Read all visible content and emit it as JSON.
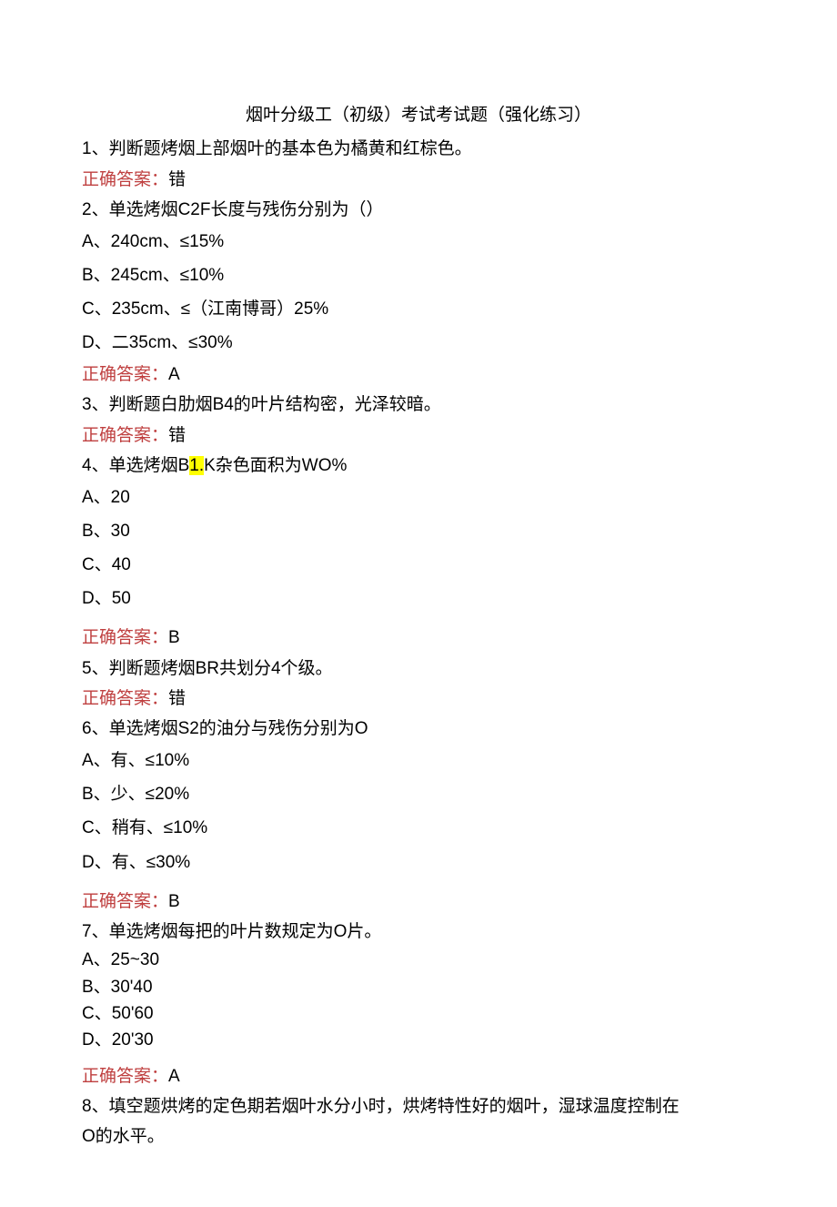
{
  "title": "烟叶分级工（初级）考试考试题（强化练习）",
  "answerLabel": "正确答案：",
  "q1": {
    "text": "1、判断题烤烟上部烟叶的基本色为橘黄和红棕色。",
    "answer": "错"
  },
  "q2": {
    "text": "2、单选烤烟C2F长度与残伤分别为（）",
    "optA": "A、240cm、≤15%",
    "optB": "B、245cm、≤10%",
    "optC": "C、235cm、≤（江南博哥）25%",
    "optD": "D、二35cm、≤30%",
    "answer": "A"
  },
  "q3": {
    "text": "3、判断题白肋烟B4的叶片结构密，光泽较暗。",
    "answer": "错"
  },
  "q4": {
    "textPre": "4、单选烤烟B",
    "hl": "1.",
    "textPost": "K杂色面积为WO%",
    "optA": "A、20",
    "optB": "B、30",
    "optC": "C、40",
    "optD": "D、50",
    "answer": "B"
  },
  "q5": {
    "text": "5、判断题烤烟BR共划分4个级。",
    "answer": "错"
  },
  "q6": {
    "text": "6、单选烤烟S2的油分与残伤分别为O",
    "optA": "A、有、≤10%",
    "optB": "B、少、≤20%",
    "optC": "C、稍有、≤10%",
    "optD": "D、有、≤30%",
    "answer": "B"
  },
  "q7": {
    "text": "7、单选烤烟每把的叶片数规定为O片。",
    "optA": "A、25~30",
    "optB": "B、30'40",
    "optC": "C、50'60",
    "optD": "D、20'30",
    "answer": "A"
  },
  "q8": {
    "line1": "8、填空题烘烤的定色期若烟叶水分小时，烘烤特性好的烟叶，湿球温度控制在",
    "line2": "O的水平。"
  }
}
